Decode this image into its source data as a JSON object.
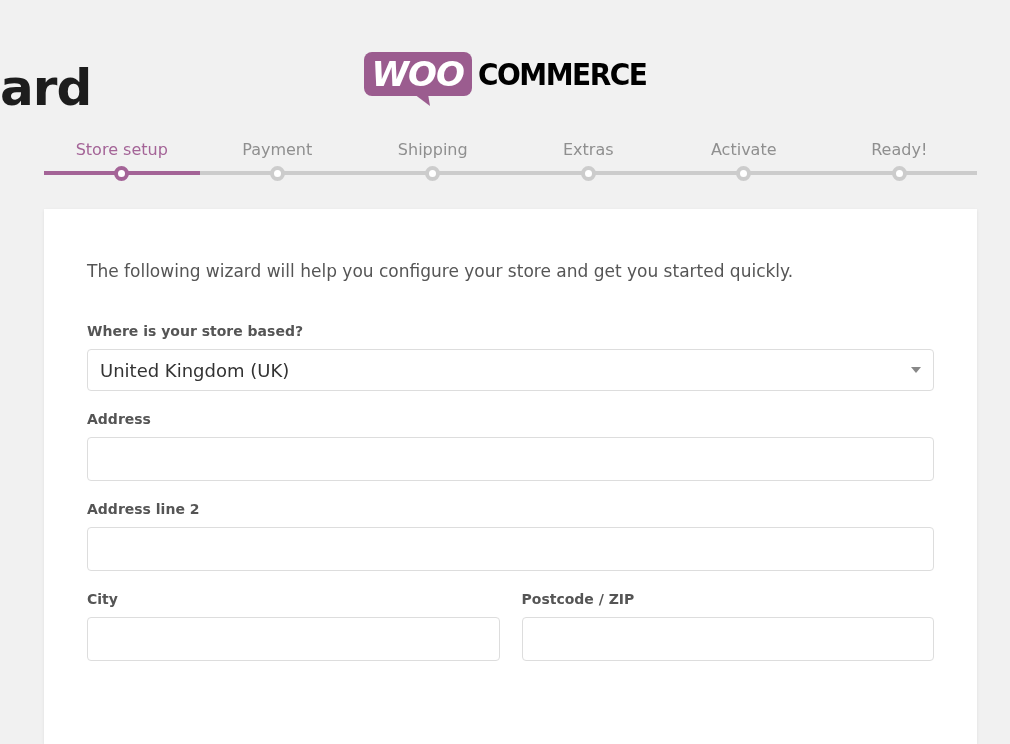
{
  "heading": "ard",
  "logo": {
    "badge": "WOO",
    "word": "COMMERCE"
  },
  "steps": [
    {
      "label": "Store setup",
      "selected": true
    },
    {
      "label": "Payment",
      "selected": false
    },
    {
      "label": "Shipping",
      "selected": false
    },
    {
      "label": "Extras",
      "selected": false
    },
    {
      "label": "Activate",
      "selected": false
    },
    {
      "label": "Ready!",
      "selected": false
    }
  ],
  "intro": "The following wizard will help you configure your store and get you started quickly.",
  "rows": [
    {
      "fields": [
        {
          "kind": "select",
          "label": "Where is your store based?",
          "value": "United Kingdom (UK)"
        }
      ]
    },
    {
      "fields": [
        {
          "kind": "text",
          "label": "Address"
        }
      ]
    },
    {
      "fields": [
        {
          "kind": "text",
          "label": "Address line 2"
        }
      ]
    },
    {
      "fields": [
        {
          "kind": "text",
          "label": "City"
        },
        {
          "kind": "text",
          "label": "Postcode / ZIP"
        }
      ]
    }
  ]
}
